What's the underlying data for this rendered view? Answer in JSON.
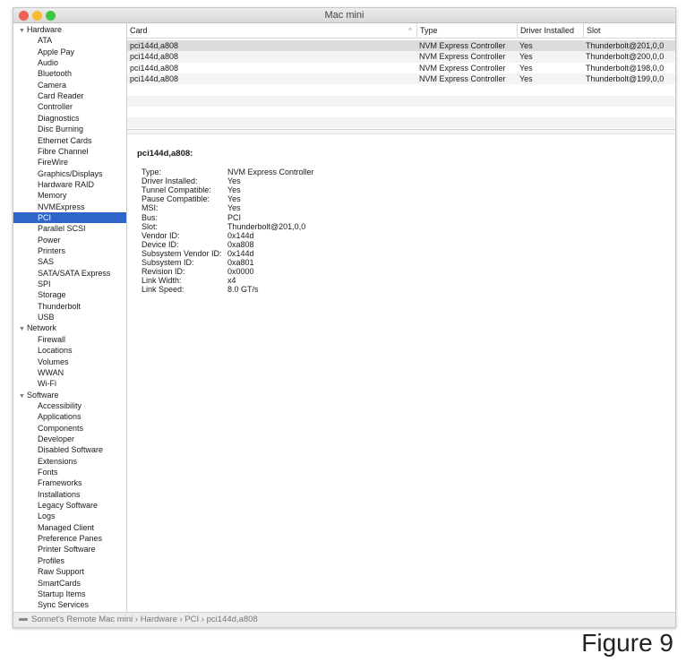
{
  "window": {
    "title": "Mac mini",
    "traffic_lights": {
      "close": "#ee5f57",
      "minimize": "#f5bd30",
      "zoom": "#3ec840"
    }
  },
  "sidebar": {
    "selected": "PCI",
    "groups": [
      {
        "label": "Hardware",
        "items": [
          "ATA",
          "Apple Pay",
          "Audio",
          "Bluetooth",
          "Camera",
          "Card Reader",
          "Controller",
          "Diagnostics",
          "Disc Burning",
          "Ethernet Cards",
          "Fibre Channel",
          "FireWire",
          "Graphics/Displays",
          "Hardware RAID",
          "Memory",
          "NVMExpress",
          "PCI",
          "Parallel SCSI",
          "Power",
          "Printers",
          "SAS",
          "SATA/SATA Express",
          "SPI",
          "Storage",
          "Thunderbolt",
          "USB"
        ]
      },
      {
        "label": "Network",
        "items": [
          "Firewall",
          "Locations",
          "Volumes",
          "WWAN",
          "Wi-Fi"
        ]
      },
      {
        "label": "Software",
        "items": [
          "Accessibility",
          "Applications",
          "Components",
          "Developer",
          "Disabled Software",
          "Extensions",
          "Fonts",
          "Frameworks",
          "Installations",
          "Legacy Software",
          "Logs",
          "Managed Client",
          "Preference Panes",
          "Printer Software",
          "Profiles",
          "Raw Support",
          "SmartCards",
          "Startup Items",
          "Sync Services"
        ]
      }
    ]
  },
  "table": {
    "columns": [
      "Card",
      "Type",
      "Driver Installed",
      "Slot"
    ],
    "sort_indicator": "^",
    "rows": [
      [
        "pci144d,a808",
        "NVM Express Controller",
        "Yes",
        "Thunderbolt@201,0,0"
      ],
      [
        "pci144d,a808",
        "NVM Express Controller",
        "Yes",
        "Thunderbolt@200,0,0"
      ],
      [
        "pci144d,a808",
        "NVM Express Controller",
        "Yes",
        "Thunderbolt@198,0,0"
      ],
      [
        "pci144d,a808",
        "NVM Express Controller",
        "Yes",
        "Thunderbolt@199,0,0"
      ]
    ]
  },
  "detail": {
    "title": "pci144d,a808:",
    "fields": [
      [
        "Type:",
        "NVM Express Controller"
      ],
      [
        "Driver Installed:",
        "Yes"
      ],
      [
        "Tunnel Compatible:",
        "Yes"
      ],
      [
        "Pause Compatible:",
        "Yes"
      ],
      [
        "MSI:",
        "Yes"
      ],
      [
        "Bus:",
        "PCI"
      ],
      [
        "Slot:",
        "Thunderbolt@201,0,0"
      ],
      [
        "Vendor ID:",
        "0x144d"
      ],
      [
        "Device ID:",
        "0xa808"
      ],
      [
        "Subsystem Vendor ID:",
        "0x144d"
      ],
      [
        "Subsystem ID:",
        "0xa801"
      ],
      [
        "Revision ID:",
        "0x0000"
      ],
      [
        "Link Width:",
        "x4"
      ],
      [
        "Link Speed:",
        "8.0 GT/s"
      ]
    ]
  },
  "breadcrumb": [
    "Sonnet's Remote Mac mini",
    "Hardware",
    "PCI",
    "pci144d,a808"
  ],
  "figure_label": "Figure 9"
}
